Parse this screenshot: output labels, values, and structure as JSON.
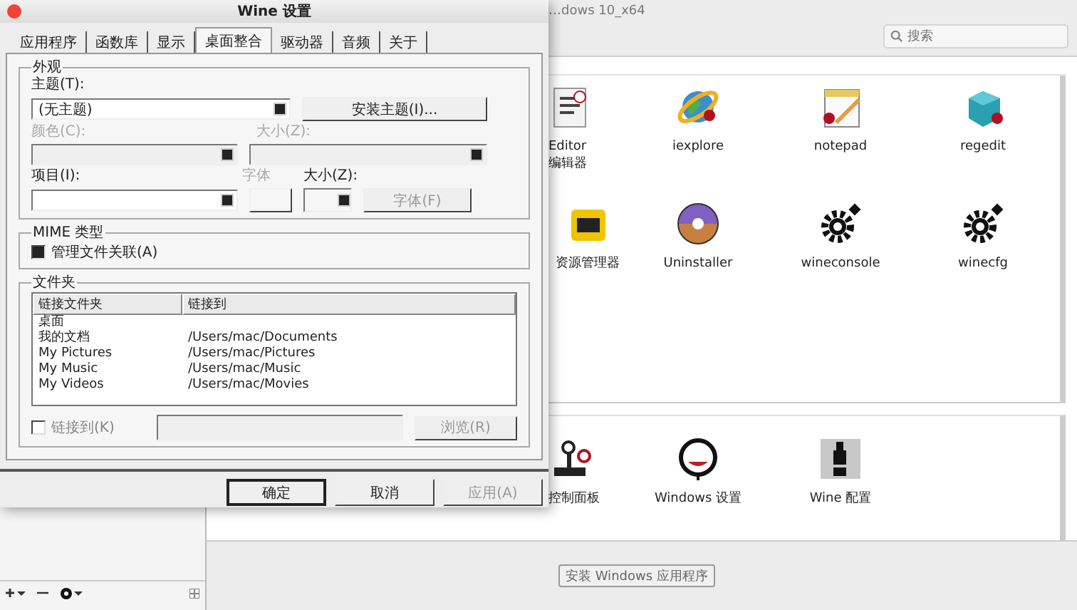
{
  "app_window": {
    "title": "…dows 10_x64",
    "search": {
      "placeholder": "搜索"
    },
    "apps": [
      {
        "label": "Editor\n编辑器",
        "kind": "document"
      },
      {
        "label": "iexplore",
        "kind": "globe"
      },
      {
        "label": "notepad",
        "kind": "notepad"
      },
      {
        "label": "regedit",
        "kind": "cube"
      },
      {
        "label": "资源管理器",
        "kind": "yellow-box"
      },
      {
        "label": "Uninstaller",
        "kind": "disc"
      },
      {
        "label": "wineconsole",
        "kind": "gear"
      },
      {
        "label": "winecfg",
        "kind": "gear"
      }
    ],
    "more_apps": [
      {
        "label": "控制面板",
        "kind": "joystick"
      },
      {
        "label": "Windows 设置",
        "kind": "clock"
      },
      {
        "label": "Wine 配置",
        "kind": "bottle"
      }
    ],
    "install_button": "安装 Windows 应用程序"
  },
  "dialog": {
    "title": "Wine 设置",
    "tabs": [
      {
        "label": "应用程序",
        "selected": false
      },
      {
        "label": "函数库",
        "selected": false
      },
      {
        "label": "显示",
        "selected": false
      },
      {
        "label": "桌面整合",
        "selected": true
      },
      {
        "label": "驱动器",
        "selected": false
      },
      {
        "label": "音频",
        "selected": false
      },
      {
        "label": "关于",
        "selected": false
      }
    ],
    "appearance": {
      "title": "外观",
      "theme": {
        "label": "主题(T):",
        "value": "(无主题)"
      },
      "install_button": "安装主题(I)...",
      "color": {
        "label": "颜色(C):",
        "disabled": true
      },
      "size": {
        "label": "大小(Z):",
        "disabled": true
      },
      "item": {
        "label": "项目(I):",
        "disabled": false
      },
      "font": {
        "label": "字体",
        "disabled": true
      },
      "item_size": {
        "label": "大小(Z):",
        "disabled": false
      },
      "font_button": {
        "label": "字体(F)",
        "disabled": true
      }
    },
    "mime": {
      "title": "MIME 类型",
      "checkbox": {
        "label": "管理文件关联(A)",
        "checked": true
      }
    },
    "folders": {
      "title": "文件夹",
      "columns": [
        "链接文件夹",
        "链接到"
      ],
      "rows": [
        {
          "name": "桌面"
        },
        {
          "name": "我的文档",
          "target": "/Users/mac/Documents"
        },
        {
          "name": "My Pictures",
          "target": "/Users/mac/Pictures"
        },
        {
          "name": "My Music",
          "target": "/Users/mac/Music"
        },
        {
          "name": "My Videos",
          "target": "/Users/mac/Movies"
        }
      ],
      "link_checkbox": {
        "label": "链接到(K)",
        "checked": false
      },
      "browse_button": {
        "label": "浏览(R)",
        "disabled": true
      }
    },
    "buttons": [
      {
        "label": "确定",
        "default": true,
        "disabled": false
      },
      {
        "label": "取消",
        "default": false,
        "disabled": false
      },
      {
        "label": "应用(A)",
        "default": false,
        "disabled": true
      }
    ]
  }
}
